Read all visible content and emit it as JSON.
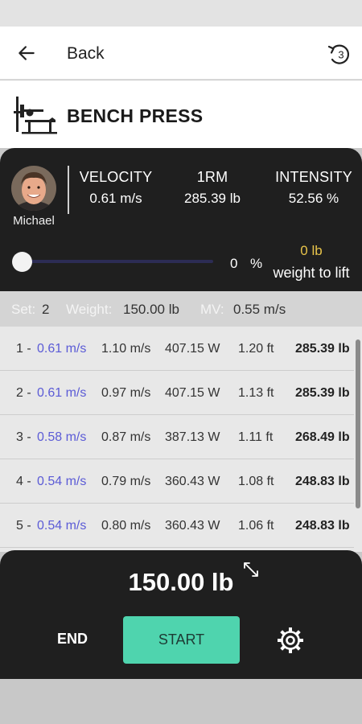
{
  "app_bar": {
    "back_label": "Back",
    "replay_icon": "replay-3-icon",
    "replay_count": "3"
  },
  "exercise": {
    "title": "BENCH PRESS",
    "icon": "bench-press-icon"
  },
  "user": {
    "name": "Michael"
  },
  "metrics": [
    {
      "label": "VELOCITY",
      "value": "0.61 m/s"
    },
    {
      "label": "1RM",
      "value": "285.39 lb"
    },
    {
      "label": "INTENSITY",
      "value": "52.56 %"
    }
  ],
  "slider": {
    "value": "0",
    "unit": "%",
    "level": 0
  },
  "weight_to_lift": {
    "value": "0 lb",
    "label": "weight to lift"
  },
  "set_info": {
    "set_label": "Set:",
    "set_value": "2",
    "weight_label": "Weight:",
    "weight_value": "150.00 lb",
    "mv_label": "MV:",
    "mv_value": "0.55 m/s"
  },
  "reps": [
    {
      "num": "1 -",
      "mean_velocity": "0.61 m/s",
      "peak_velocity": "1.10 m/s",
      "power": "407.15 W",
      "distance": "1.20 ft",
      "one_rm": "285.39 lb"
    },
    {
      "num": "2 -",
      "mean_velocity": "0.61 m/s",
      "peak_velocity": "0.97 m/s",
      "power": "407.15 W",
      "distance": "1.13 ft",
      "one_rm": "285.39 lb"
    },
    {
      "num": "3 -",
      "mean_velocity": "0.58 m/s",
      "peak_velocity": "0.87 m/s",
      "power": "387.13 W",
      "distance": "1.11 ft",
      "one_rm": "268.49 lb"
    },
    {
      "num": "4 -",
      "mean_velocity": "0.54 m/s",
      "peak_velocity": "0.79 m/s",
      "power": "360.43 W",
      "distance": "1.08 ft",
      "one_rm": "248.83 lb"
    },
    {
      "num": "5 -",
      "mean_velocity": "0.54 m/s",
      "peak_velocity": "0.80 m/s",
      "power": "360.43 W",
      "distance": "1.06 ft",
      "one_rm": "248.83 lb"
    }
  ],
  "bottom": {
    "weight": "150.00 lb",
    "end_label": "END",
    "start_label": "START"
  },
  "colors": {
    "accent": "#4fd4ae",
    "velocity": "#5b5bd6",
    "highlight": "#e8c44a",
    "panel": "#1f1f1f"
  }
}
